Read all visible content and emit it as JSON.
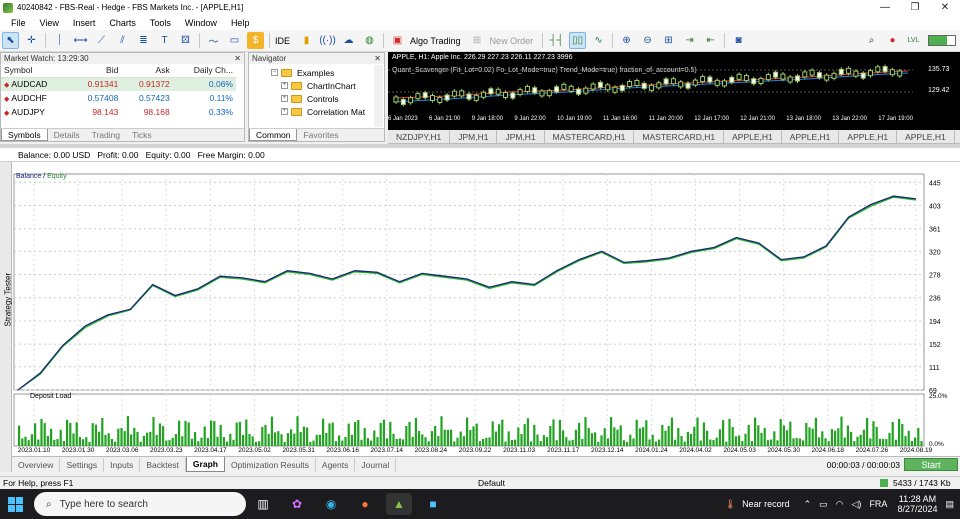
{
  "window": {
    "title": "40240842 - FBS-Real - Hedge - FBS Markets Inc. - [APPLE,H1]"
  },
  "menu": [
    "File",
    "View",
    "Insert",
    "Charts",
    "Tools",
    "Window",
    "Help"
  ],
  "toolbar": {
    "ide": "IDE",
    "algo": "Algo Trading",
    "neworder": "New Order",
    "lvl": "LVL"
  },
  "market_watch": {
    "title": "Market Watch: 13:29:30",
    "cols": [
      "Symbol",
      "Bid",
      "Ask",
      "Daily Ch..."
    ],
    "rows": [
      {
        "symbol": "AUDCAD",
        "bid": "0.91341",
        "ask": "0.91372",
        "change": "0.06%"
      },
      {
        "symbol": "AUDCHF",
        "bid": "0.57408",
        "ask": "0.57423",
        "change": "0.11%"
      },
      {
        "symbol": "AUDJPY",
        "bid": "98.143",
        "ask": "98.168",
        "change": "0.33%"
      }
    ],
    "tabs": [
      "Symbols",
      "Details",
      "Trading",
      "Ticks"
    ]
  },
  "navigator": {
    "title": "Navigator",
    "items": [
      "Examples",
      "ChartInChart",
      "Controls",
      "Correlation Mat"
    ],
    "tabs": [
      "Common",
      "Favorites"
    ]
  },
  "chart": {
    "info": "APPLE, H1: Apple Inc. 226.29 227.23 226.11 227.23 3996",
    "indicator": "Quant_Scavenger (Fit_Lot=0.02) Fo_Lot_Mode=true) Trend_Mode=true) fraction_of_account=0.5)",
    "prices": [
      "135.73",
      "129.42"
    ],
    "dates": [
      "6 Jan 2023",
      "6 Jan 21:00",
      "9 Jan 18:00",
      "9 Jan 22:00",
      "10 Jan 19:00",
      "11 Jan 16:00",
      "11 Jan 20:00",
      "12 Jan 17:00",
      "12 Jan 21:00",
      "13 Jan 18:00",
      "13 Jan 22:00",
      "17 Jan 19:00"
    ]
  },
  "chart_tabs": [
    "NZDJPY,H1",
    "JPM,H1",
    "JPM,H1",
    "MASTERCARD,H1",
    "MASTERCARD,H1",
    "APPLE,H1",
    "APPLE,H1",
    "APPLE,H1",
    "APPLE,H1"
  ],
  "balance_bar": {
    "balance": "Balance: 0.00 USD",
    "profit": "Profit: 0.00",
    "equity": "Equity: 0.00",
    "margin": "Free Margin: 0.00"
  },
  "strategy_tester_label": "Strategy Tester",
  "graph": {
    "legend_balance": "Balance",
    "legend_sep": " / ",
    "legend_equity": "Equity",
    "deposit_label": "Deposit Load",
    "y_ticks": [
      "445",
      "403",
      "361",
      "320",
      "278",
      "236",
      "194",
      "152",
      "111",
      "69"
    ],
    "load_ticks": [
      "25.0%",
      "0.0%"
    ],
    "x_ticks": [
      "2023.01.10",
      "2023.01.30",
      "2023.03.06",
      "2023.03.23",
      "2023.04.17",
      "2023.05.02",
      "2023.05.31",
      "2023.06.16",
      "2023.07.14",
      "2023.08.24",
      "2023.09.22",
      "2023.11.03",
      "2023.11.17",
      "2023.12.14",
      "2024.01.24",
      "2024.04.02",
      "2024.05.03",
      "2024.05.30",
      "2024.06.18",
      "2024.07.26",
      "2024.08.19"
    ]
  },
  "bottom_tabs": [
    "Overview",
    "Settings",
    "Inputs",
    "Backtest",
    "Graph",
    "Optimization Results",
    "Agents",
    "Journal"
  ],
  "timer": "00:00:03 / 00:00:03",
  "start_label": "Start",
  "status": {
    "help": "For Help, press F1",
    "profile": "Default",
    "traffic": "5433 / 1743 Kb"
  },
  "taskbar": {
    "search_placeholder": "Type here to search",
    "news": "Near record",
    "lang": "FRA",
    "time": "11:28 AM",
    "date": "8/27/2024"
  },
  "chart_data": {
    "type": "line",
    "title": "",
    "xlabel": "",
    "ylabel": "",
    "ylim": [
      69,
      460
    ],
    "series": [
      {
        "name": "Balance",
        "values": [
          69,
          100,
          150,
          185,
          205,
          215,
          260,
          240,
          252,
          275,
          272,
          265,
          285,
          280,
          270,
          285,
          282,
          265,
          280,
          275,
          270,
          255,
          265,
          260,
          285,
          305,
          320,
          300,
          303,
          308,
          320,
          327,
          345,
          335,
          305,
          310,
          330,
          382,
          405,
          420,
          415
        ]
      },
      {
        "name": "Equity",
        "values": [
          69,
          98,
          148,
          182,
          203,
          214,
          258,
          238,
          250,
          273,
          270,
          263,
          283,
          278,
          268,
          283,
          280,
          263,
          278,
          273,
          268,
          253,
          263,
          258,
          283,
          303,
          318,
          298,
          301,
          306,
          318,
          325,
          343,
          333,
          303,
          308,
          328,
          380,
          402,
          418,
          413
        ]
      }
    ],
    "x_ticks": [
      "2023.01.10",
      "2023.01.30",
      "2023.03.06",
      "2023.03.23",
      "2023.04.17",
      "2023.05.02",
      "2023.05.31",
      "2023.06.16",
      "2023.07.14",
      "2023.08.24",
      "2023.09.22",
      "2023.11.03",
      "2023.11.17",
      "2023.12.14",
      "2024.01.24",
      "2024.04.02",
      "2024.05.03",
      "2024.05.30",
      "2024.06.18",
      "2024.07.26",
      "2024.08.19"
    ],
    "secondary": {
      "name": "Deposit Load",
      "ylim": [
        0,
        25
      ]
    }
  }
}
